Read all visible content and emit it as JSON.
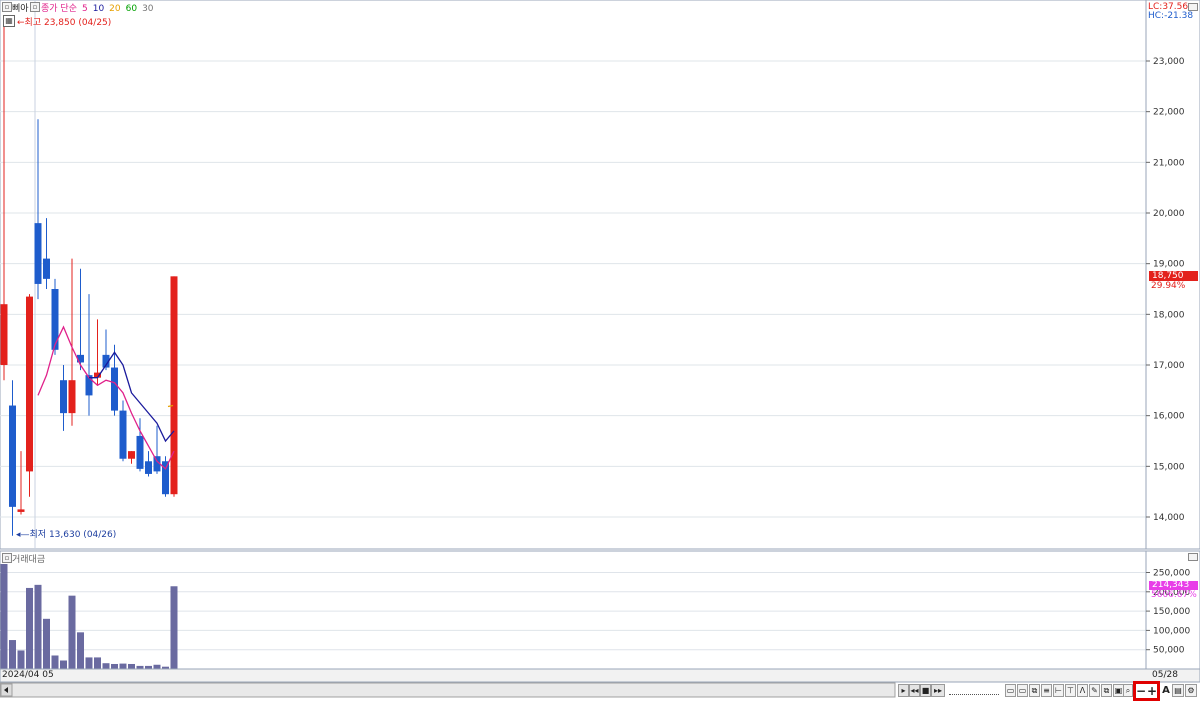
{
  "header": {
    "toggle_label": "▣",
    "name_label": "삐아",
    "ma_prefix": "종가 단순",
    "ma_periods": [
      "5",
      "10",
      "20",
      "60",
      "30"
    ],
    "ma_colors": [
      "#e0218a",
      "#1a1a9c",
      "#e6a000",
      "#00a000",
      "#777777"
    ],
    "high_label": "최고 23,850 (04/25)",
    "low_label": "최저 13,630 (04/26)"
  },
  "right_info": {
    "lc": "LC:37.56",
    "hc": "HC:-21.38",
    "price_tag": "18,750",
    "price_change": "29.94%",
    "volume_tag": "214,343",
    "volume_change": "5606.67%"
  },
  "volume_panel": {
    "title": "거래대금"
  },
  "time_axis": {
    "start_label": "2024/04 05",
    "end_label": "05/28"
  },
  "colors": {
    "up": "#e3211c",
    "down": "#1e5ccc",
    "volume": "#6a6aa0",
    "ma5": "#e0218a",
    "ma10": "#1a1a9c",
    "tag_red": "#e3211c",
    "tag_magenta": "#e83ee8",
    "highlight": "#e00000"
  },
  "toolbar": {
    "minus_label": "−",
    "plus_label": "+",
    "a_label": "A"
  },
  "chart_data": {
    "type": "candlestick",
    "price_axis": {
      "ticks": [
        "14,000",
        "15,000",
        "16,000",
        "17,000",
        "18,000",
        "19,000",
        "20,000",
        "21,000",
        "22,000",
        "23,000"
      ],
      "ylim": [
        13500,
        24100
      ]
    },
    "candles": [
      {
        "o": 17000,
        "h": 23850,
        "l": 16700,
        "c": 18200
      },
      {
        "o": 16200,
        "h": 16700,
        "l": 13630,
        "c": 14200
      },
      {
        "o": 14100,
        "h": 15300,
        "l": 14050,
        "c": 14150
      },
      {
        "o": 14900,
        "h": 18400,
        "l": 14400,
        "c": 18350
      },
      {
        "o": 19800,
        "h": 21850,
        "l": 18300,
        "c": 18600
      },
      {
        "o": 19100,
        "h": 19900,
        "l": 18500,
        "c": 18700
      },
      {
        "o": 18500,
        "h": 18700,
        "l": 17200,
        "c": 17300
      },
      {
        "o": 16700,
        "h": 17000,
        "l": 15700,
        "c": 16050
      },
      {
        "o": 16050,
        "h": 19100,
        "l": 15800,
        "c": 16700
      },
      {
        "o": 17200,
        "h": 18900,
        "l": 16900,
        "c": 17050
      },
      {
        "o": 16800,
        "h": 18400,
        "l": 16000,
        "c": 16400
      },
      {
        "o": 16750,
        "h": 17900,
        "l": 16600,
        "c": 16850
      },
      {
        "o": 17200,
        "h": 17700,
        "l": 16900,
        "c": 16950
      },
      {
        "o": 16950,
        "h": 17400,
        "l": 16000,
        "c": 16100
      },
      {
        "o": 16100,
        "h": 16300,
        "l": 15100,
        "c": 15150
      },
      {
        "o": 15150,
        "h": 15300,
        "l": 15050,
        "c": 15300
      },
      {
        "o": 15600,
        "h": 15950,
        "l": 14900,
        "c": 14950
      },
      {
        "o": 15100,
        "h": 15300,
        "l": 14800,
        "c": 14850
      },
      {
        "o": 15200,
        "h": 15800,
        "l": 14850,
        "c": 14900
      },
      {
        "o": 15100,
        "h": 15200,
        "l": 14400,
        "c": 14450
      },
      {
        "o": 14450,
        "h": 18750,
        "l": 14400,
        "c": 18750
      }
    ],
    "ma5": [
      null,
      null,
      null,
      null,
      16400,
      16800,
      17400,
      17750,
      17350,
      17000,
      16750,
      16600,
      16700,
      16650,
      16450,
      16050,
      15700,
      15400,
      15100,
      14950,
      15300
    ],
    "ma10": [
      null,
      null,
      null,
      null,
      null,
      null,
      null,
      null,
      null,
      null,
      16750,
      16750,
      17000,
      17250,
      17000,
      16450,
      16250,
      16050,
      15850,
      15500,
      15700
    ],
    "ma20_last": 16200,
    "volume_axis": {
      "ticks": [
        "50,000",
        "100,000",
        "150,000",
        "200,000",
        "250,000"
      ],
      "ylim": [
        0,
        275000
      ]
    },
    "volume": [
      272000,
      75000,
      48000,
      210000,
      218000,
      130000,
      35000,
      22000,
      190000,
      95000,
      30000,
      30000,
      15000,
      13000,
      14000,
      13000,
      8000,
      8000,
      11000,
      6000,
      214343
    ]
  }
}
